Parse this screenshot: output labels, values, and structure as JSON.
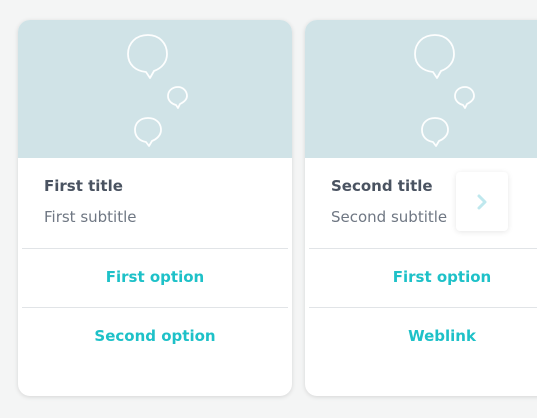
{
  "cards": [
    {
      "image_icon": "speech-bubbles-icon",
      "title": "First title",
      "subtitle": "First subtitle",
      "options": [
        "First option",
        "Second option"
      ]
    },
    {
      "image_icon": "speech-bubbles-icon",
      "title": "Second title",
      "subtitle": "Second subtitle",
      "options": [
        "First option",
        "Weblink"
      ]
    }
  ],
  "navigation": {
    "next_icon": "chevron-right-icon"
  },
  "colors": {
    "background": "#f4f5f5",
    "card_image": "#d0e3e7",
    "accent": "#1ec1c8",
    "title": "#4a5361",
    "subtitle": "#6f7783",
    "chevron": "#bfe8ee"
  }
}
